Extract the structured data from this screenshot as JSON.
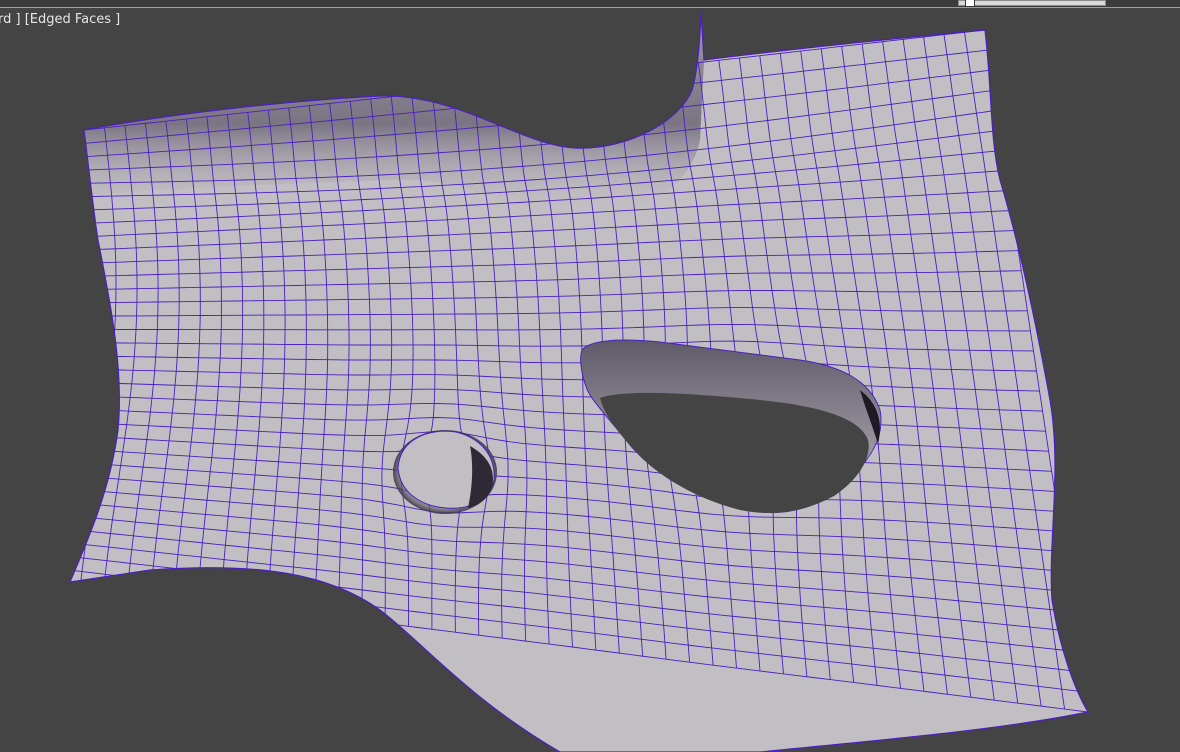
{
  "viewport": {
    "label": "rd ] [Edged Faces ]",
    "shading_mode": "Edged Faces",
    "background_color": "#444444",
    "mesh_surface_color": "#c2bfc4",
    "mesh_wire_color": "#4b1fbf",
    "hole_shadow_color": "#2a2630"
  },
  "mesh": {
    "name": "deformed-plane-with-holes",
    "features": [
      "raised-ridge",
      "vertical-spike",
      "round-hole",
      "slot-hole"
    ]
  }
}
